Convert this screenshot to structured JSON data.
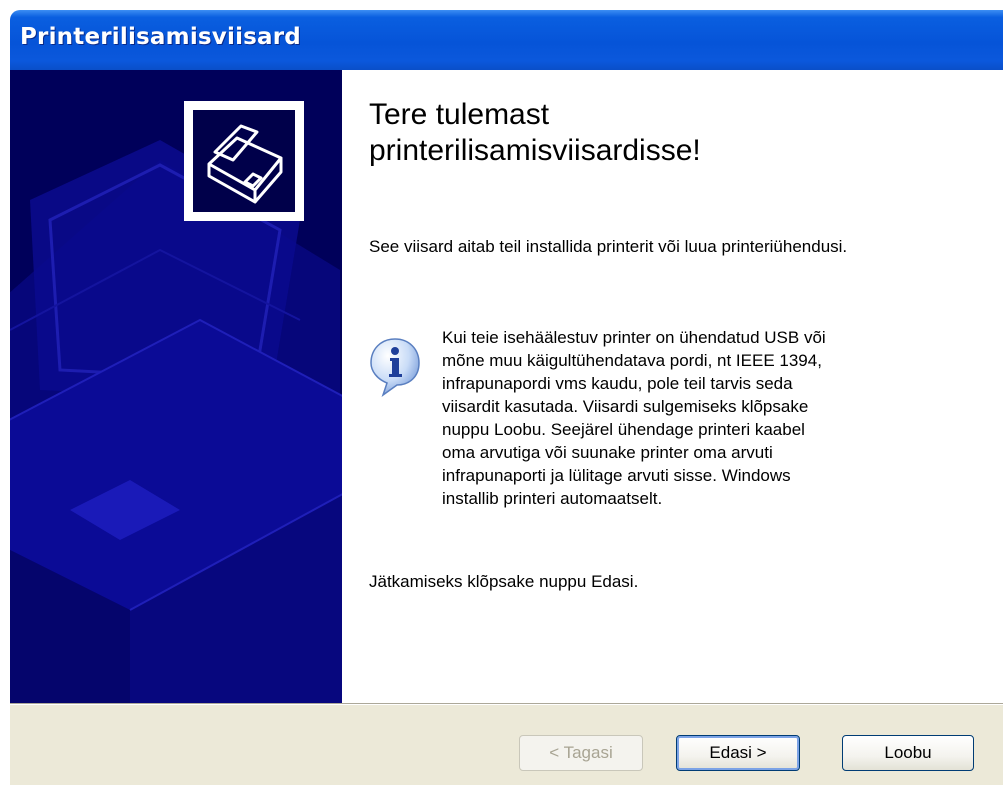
{
  "window": {
    "title": "Printerilisamisviisard"
  },
  "main": {
    "heading_line1": "Tere tulemast",
    "heading_line2": "printerilisamisviisardisse!",
    "intro": "See viisard aitab teil installida printerit või luua printeriühendusi.",
    "info_text": "Kui teie isehäälestuv printer on ühendatud USB või\nmõne muu käigultühendatava pordi, nt IEEE 1394,\ninfrapunapordi vms kaudu, pole teil tarvis seda\nviisardit kasutada. Viisardi sulgemiseks klõpsake\nnuppu Loobu. Seejärel ühendage printeri kaabel\noma arvutiga või suunake printer oma arvuti\ninfrapunaporti ja lülitage arvuti sisse. Windows\ninstallib printeri automaatselt.",
    "continue_text": "Jätkamiseks klõpsake nuppu Edasi."
  },
  "buttons": {
    "back_label": "< Tagasi",
    "next_label": "Edasi >",
    "cancel_label": "Loobu"
  },
  "icons": {
    "wizard_icon": "printer-icon",
    "info_icon": "info-icon"
  },
  "colors": {
    "titlebar": "#0654d8",
    "side_panel": "#00005a",
    "footer": "#ece9d8"
  }
}
